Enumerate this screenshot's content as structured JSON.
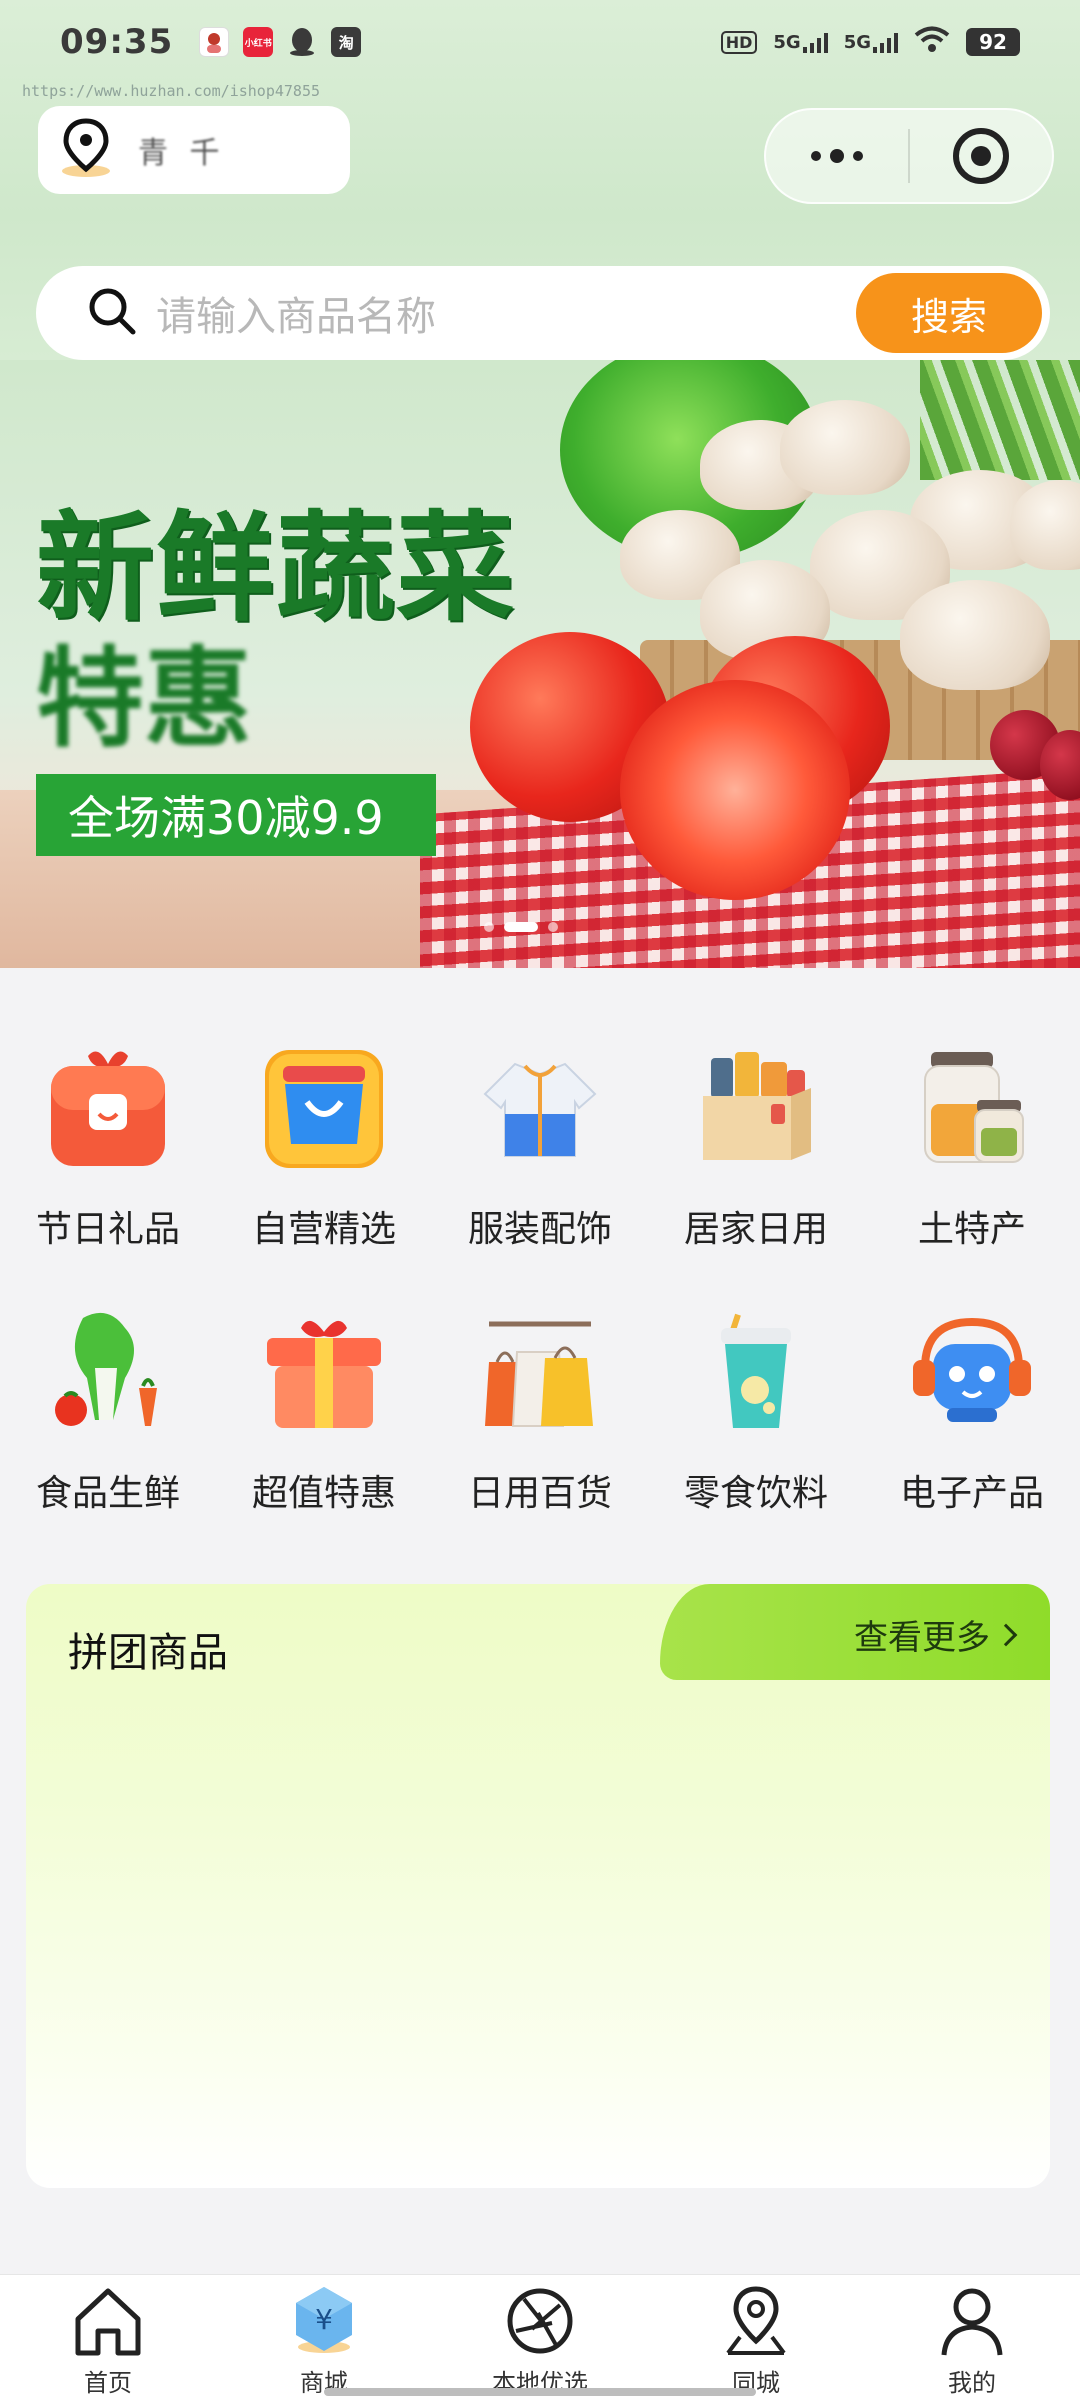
{
  "status_bar": {
    "time": "09:35",
    "app_icons": [
      {
        "name": "avatar-app-icon",
        "text": "",
        "color": "#ffffff"
      },
      {
        "name": "xiaohongshu-app-icon",
        "text": "小红书",
        "color": "#e8243a"
      },
      {
        "name": "qq-app-icon",
        "text": "",
        "color": "#3a3a3a"
      },
      {
        "name": "taobao-app-icon",
        "text": "淘",
        "color": "#3a3a3a"
      }
    ],
    "hd_label": "HD",
    "signal_1": "5G",
    "signal_2": "5G",
    "battery": "92"
  },
  "watermark": "https://www.huzhan.com/ishop47855",
  "location": {
    "text": "青 千"
  },
  "search": {
    "placeholder": "请输入商品名称",
    "button": "搜索"
  },
  "banner": {
    "title": "新鲜蔬菜",
    "subtitle": "特惠",
    "promo": "全场满30减9.9",
    "slides": 3,
    "active_slide": 2
  },
  "categories": [
    {
      "label": "节日礼品",
      "icon": "red-gift-box-icon"
    },
    {
      "label": "自营精选",
      "icon": "shopping-bag-icon"
    },
    {
      "label": "服装配饰",
      "icon": "jacket-icon"
    },
    {
      "label": "居家日用",
      "icon": "household-box-icon"
    },
    {
      "label": "土特产",
      "icon": "jar-icon"
    },
    {
      "label": "食品生鲜",
      "icon": "vegetables-icon"
    },
    {
      "label": "超值特惠",
      "icon": "gift-icon"
    },
    {
      "label": "日用百货",
      "icon": "shopping-bags-icon"
    },
    {
      "label": "零食饮料",
      "icon": "drink-cup-icon"
    },
    {
      "label": "电子产品",
      "icon": "robot-headphone-icon"
    }
  ],
  "group_buy": {
    "title": "拼团商品",
    "more": "查看更多"
  },
  "tabbar": [
    {
      "label": "首页",
      "icon": "home-icon",
      "active": false
    },
    {
      "label": "商城",
      "icon": "mall-icon",
      "active": true
    },
    {
      "label": "本地优选",
      "icon": "aperture-icon",
      "active": false
    },
    {
      "label": "同城",
      "icon": "location-pin-icon",
      "active": false
    },
    {
      "label": "我的",
      "icon": "profile-icon",
      "active": false
    }
  ],
  "colors": {
    "accent_orange": "#f7931a",
    "brand_green": "#28a436",
    "banner_title_green": "#1a7a28"
  }
}
